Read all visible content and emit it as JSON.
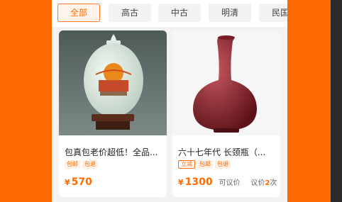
{
  "tabs": [
    {
      "label": "全部",
      "active": true
    },
    {
      "label": "高古",
      "active": false
    },
    {
      "label": "中古",
      "active": false
    },
    {
      "label": "明清",
      "active": false
    },
    {
      "label": "民国",
      "active": false
    }
  ],
  "products": [
    {
      "title": "包真包老价超低！全品...",
      "tags": [
        "包邮",
        "包退"
      ],
      "currency": "¥",
      "price": "570"
    },
    {
      "title": "六十七年代 长颈瓶（...",
      "tags": [
        "立减",
        "包邮",
        "包退"
      ],
      "currency": "¥",
      "price": "1300",
      "negotiable": "可议价",
      "bargain_label": "议价",
      "bargain_count": "2",
      "bargain_unit": "次"
    }
  ],
  "colors": {
    "accent": "#ff6a00",
    "bg": "#ff6a00"
  }
}
